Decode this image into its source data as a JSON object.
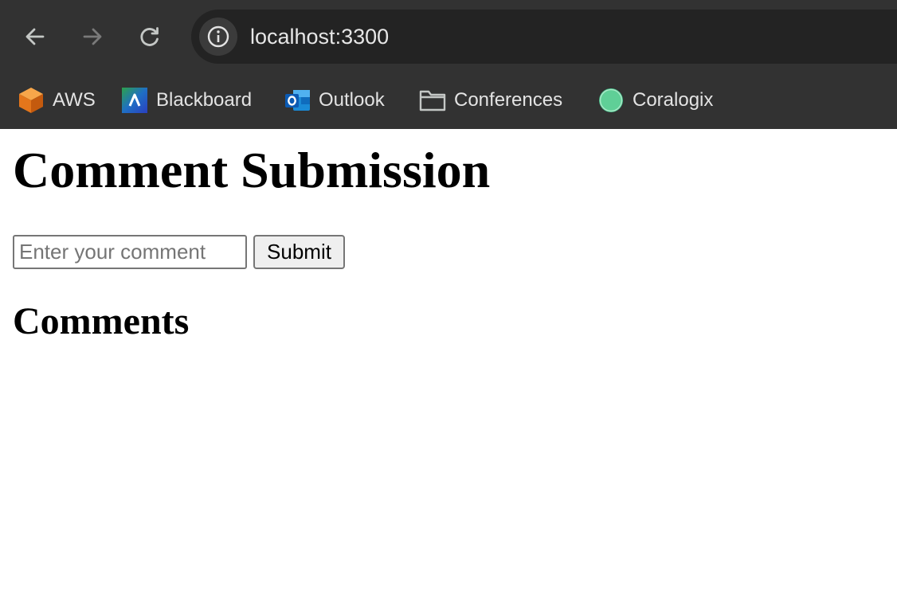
{
  "browser": {
    "url": "localhost:3300",
    "icons": {
      "back": "arrow-left-icon",
      "forward": "arrow-right-icon",
      "reload": "reload-icon",
      "site_info": "info-icon"
    },
    "bookmarks": [
      {
        "label": "AWS",
        "icon": "aws-cube-icon"
      },
      {
        "label": "Blackboard",
        "icon": "blackboard-icon"
      },
      {
        "label": "Outlook",
        "icon": "outlook-icon"
      },
      {
        "label": "Conferences",
        "icon": "folder-icon"
      },
      {
        "label": "Coralogix",
        "icon": "coralogix-icon"
      }
    ],
    "colors": {
      "chrome_bg": "#323232",
      "omnibox_bg": "#232323",
      "text": "#e3e3e3"
    }
  },
  "page": {
    "title": "Comment Submission",
    "comment_input": {
      "placeholder": "Enter your comment",
      "value": ""
    },
    "submit_label": "Submit",
    "comments_heading": "Comments",
    "comments": []
  }
}
